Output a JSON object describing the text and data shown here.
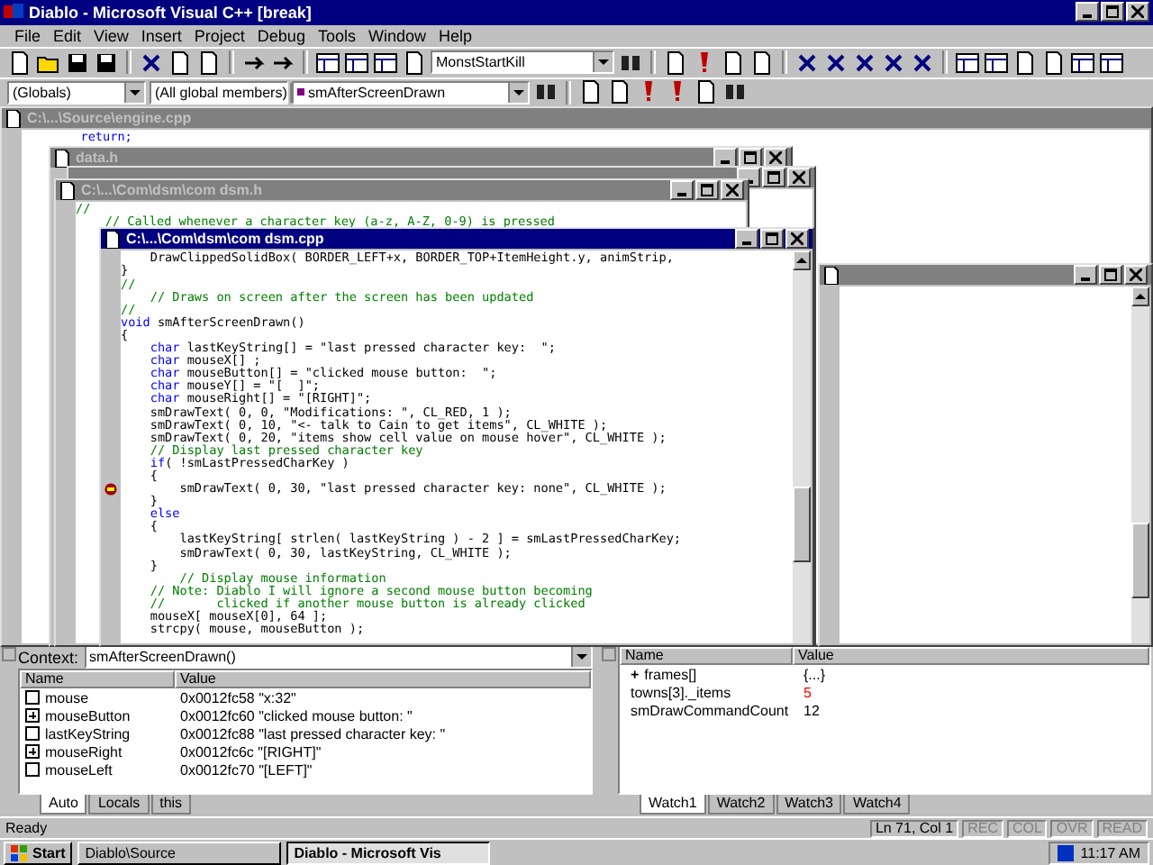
{
  "window": {
    "title": "Diablo - Microsoft Visual C++ [break]"
  },
  "menu": [
    "File",
    "Edit",
    "View",
    "Insert",
    "Project",
    "Debug",
    "Tools",
    "Window",
    "Help"
  ],
  "find_combo": {
    "value": "MonstStartKill"
  },
  "wizard_bar": {
    "class": "(Globals)",
    "filter": "(All global members)",
    "member": "smAfterScreenDrawn"
  },
  "windows": [
    {
      "title": "C:\\...\\Source\\engine.cpp",
      "active": false,
      "lines": [
        {
          "kind": "code",
          "kw": "        return;"
        }
      ]
    },
    {
      "title": "data.h",
      "active": false
    },
    {
      "active": false
    },
    {
      "title": "C:\\...\\Com\\dsm\\com dsm.h",
      "active": false,
      "lines": [
        {
          "kind": "comment",
          "text": "//"
        },
        {
          "kind": "comment",
          "text": "    // Called whenever a character key (a-z, A-Z, 0-9) is pressed"
        }
      ]
    },
    {
      "active": false
    },
    {
      "title": "C:\\...\\Com\\dsm\\com dsm.cpp",
      "active": true,
      "lines": [
        {
          "kind": "code",
          "text": "    DrawClippedSolidBox( BORDER_LEFT+x, BORDER_TOP+ItemHeight.y, animStrip,",
          "breakpoint": false
        },
        {
          "kind": "code",
          "text": "}",
          "breakpoint": false
        },
        {
          "kind": "comment",
          "text": "//",
          "breakpoint": false
        },
        {
          "kind": "comment",
          "text": "    // Draws on screen after the screen has been updated",
          "breakpoint": false
        },
        {
          "kind": "comment",
          "text": "//",
          "breakpoint": false
        },
        {
          "kind": "code",
          "kw": "void",
          "text": " smAfterScreenDrawn()",
          "breakpoint": false
        },
        {
          "kind": "code",
          "text": "{",
          "breakpoint": false
        },
        {
          "kind": "code",
          "kw": "    char",
          "text": " lastKeyString[] = \"last pressed character key:  \";",
          "breakpoint": false
        },
        {
          "kind": "code",
          "kw": "    char",
          "text": " mouseX[] ;",
          "breakpoint": false
        },
        {
          "kind": "code",
          "kw": "    char",
          "text": " mouseButton[] = \"clicked mouse button:  \";",
          "breakpoint": false
        },
        {
          "kind": "code",
          "kw": "    char",
          "text": " mouseY[] = \"[  ]\";",
          "breakpoint": false
        },
        {
          "kind": "code",
          "kw": "    char",
          "text": " mouseRight[] = \"[RIGHT]\";",
          "breakpoint": false
        },
        {
          "kind": "code",
          "text": "    smDrawText( 0, 0, \"Modifications: \", CL_RED, 1 );",
          "breakpoint": false
        },
        {
          "kind": "code",
          "text": "    smDrawText( 0, 10, \"<- talk to Cain to get items\", CL_WHITE );",
          "breakpoint": false
        },
        {
          "kind": "code",
          "text": "    smDrawText( 0, 20, \"items show cell value on mouse hover\", CL_WHITE );",
          "breakpoint": false
        },
        {
          "kind": "comment",
          "text": "    // Display last pressed character key",
          "breakpoint": false
        },
        {
          "kind": "code",
          "kw": "    if",
          "text": "( !smLastPressedCharKey )",
          "breakpoint": false
        },
        {
          "kind": "code",
          "text": "    {",
          "breakpoint": false
        },
        {
          "kind": "code",
          "text": "        smDrawText( 0, 30, \"last pressed character key: none\", CL_WHITE );",
          "breakpoint": true
        },
        {
          "kind": "code",
          "text": "    }",
          "breakpoint": false
        },
        {
          "kind": "code",
          "kw": "    else",
          "breakpoint": false
        },
        {
          "kind": "code",
          "text": "    {",
          "breakpoint": false
        },
        {
          "kind": "code",
          "text": "        lastKeyString[ strlen( lastKeyString ) - 2 ] = smLastPressedCharKey;",
          "breakpoint": false
        },
        {
          "kind": "code",
          "text": "        smDrawText( 0, 30, lastKeyString, CL_WHITE );",
          "breakpoint": false
        },
        {
          "kind": "code",
          "text": "    }",
          "breakpoint": false
        },
        {
          "kind": "comment",
          "text": "        // Display mouse information",
          "breakpoint": false
        },
        {
          "kind": "comment",
          "text": "    // Note: Diablo I will ignore a second mouse button becoming",
          "breakpoint": false
        },
        {
          "kind": "comment",
          "text": "    //       clicked if another mouse button is already clicked",
          "breakpoint": false
        },
        {
          "kind": "code",
          "text": "    mouseX[ mouseX[0], 64 ];",
          "breakpoint": false
        },
        {
          "kind": "code",
          "text": "    strcpy( mouse, mouseButton );",
          "breakpoint": false
        }
      ]
    }
  ],
  "variables": {
    "context_label": "Context:",
    "context": "smAfterScreenDrawn()",
    "columns": [
      "Name",
      "Value"
    ],
    "rows": [
      {
        "name": "mouse",
        "value": "0x0012fc58 \"x:32\"",
        "expandable": false
      },
      {
        "name": "mouseButton",
        "value": "0x0012fc60 \"clicked mouse button: \"",
        "expandable": true
      },
      {
        "name": "lastKeyString",
        "value": "0x0012fc88 \"last pressed character key: \"",
        "expandable": false
      },
      {
        "name": "mouseRight",
        "value": "0x0012fc6c \"[RIGHT]\"",
        "expandable": true
      },
      {
        "name": "mouseLeft",
        "value": "0x0012fc70 \"[LEFT]\"",
        "expandable": false
      }
    ],
    "tabs": [
      {
        "label": "Auto",
        "selected": true
      },
      {
        "label": "Locals",
        "selected": false
      },
      {
        "label": "this",
        "selected": false
      }
    ]
  },
  "watch": {
    "columns": [
      "Name",
      "Value"
    ],
    "rows": [
      {
        "expander": "+",
        "name": "frames[]",
        "value": "{...}",
        "changed": false
      },
      {
        "name": "towns[3]._items",
        "value": "5",
        "changed": true
      },
      {
        "name": "smDrawCommandCount",
        "value": "12",
        "changed": false
      }
    ],
    "tabs": [
      {
        "label": "Watch1",
        "selected": true
      },
      {
        "label": "Watch2",
        "selected": false
      },
      {
        "label": "Watch3",
        "selected": false
      },
      {
        "label": "Watch4",
        "selected": false
      }
    ]
  },
  "status_bar": {
    "message": "Ready",
    "position": "Ln 71, Col 1",
    "indicators": [
      "REC",
      "COL",
      "OVR",
      "READ"
    ]
  },
  "taskbar": {
    "start": "Start",
    "tasks": [
      {
        "label": "Diablo\\Source",
        "selected": false
      },
      {
        "label": "Diablo - Microsoft Vis",
        "selected": true
      }
    ],
    "clock": "11:17 AM"
  }
}
